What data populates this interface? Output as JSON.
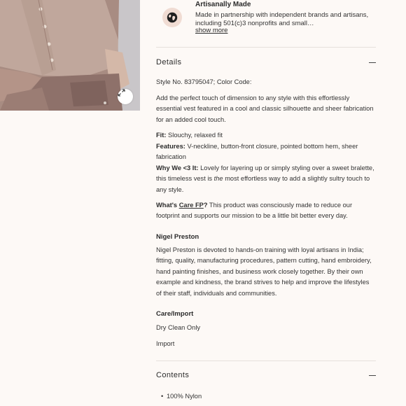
{
  "artisan": {
    "title": "Artisanally Made",
    "text": "Made in partnership with independent brands and artisans, including 501(c)3 nonprofits and small…",
    "show_more": "show more"
  },
  "details": {
    "title": "Details",
    "style_line": "Style No. 83795047; Color Code:",
    "description": "Add the perfect touch of dimension to any style with this effortlessly essential vest featured in a cool and classic silhouette and sheer fabrication for an added cool touch.",
    "fit_label": "Fit:",
    "fit_value": " Slouchy, relaxed fit",
    "features_label": "Features:",
    "features_value": " V-neckline, button-front closure, pointed bottom hem, sheer fabrication",
    "why_label": "Why We <3 It:",
    "why_value_1": " Lovely for layering up or simply styling over a sweet bralette, this timeless vest is ",
    "why_em": "the",
    "why_value_2": " most effortless way to add a slightly sultry touch to any style.",
    "whats_label": "What's ",
    "care_fp": "Care FP",
    "q": "?",
    "whats_value": " This product was consciously made to reduce our footprint and supports our mission to be a little bit better every day.",
    "brand_heading": "Nigel Preston",
    "brand_text": "Nigel Preston is devoted to hands-on training with loyal artisans in India; fitting, quality, manufacturing procedures, pattern cutting, hand embroidery, hand painting finishes, and business work closely together. By their own example and kindness, the brand strives to help and improve the lifestyles of their staff, individuals and communities.",
    "care_heading": "Care/Import",
    "care_value": "Dry Clean Only",
    "import_value": "Import"
  },
  "contents": {
    "title": "Contents",
    "items": [
      "100% Nylon"
    ]
  },
  "icons": {
    "globe": "globe-icon",
    "expand": "expand-icon",
    "collapse": "minus-icon"
  },
  "colors": {
    "background": "#fdf9f6",
    "globe_bg": "#f0dcd3",
    "divider": "#e6e1dc"
  }
}
